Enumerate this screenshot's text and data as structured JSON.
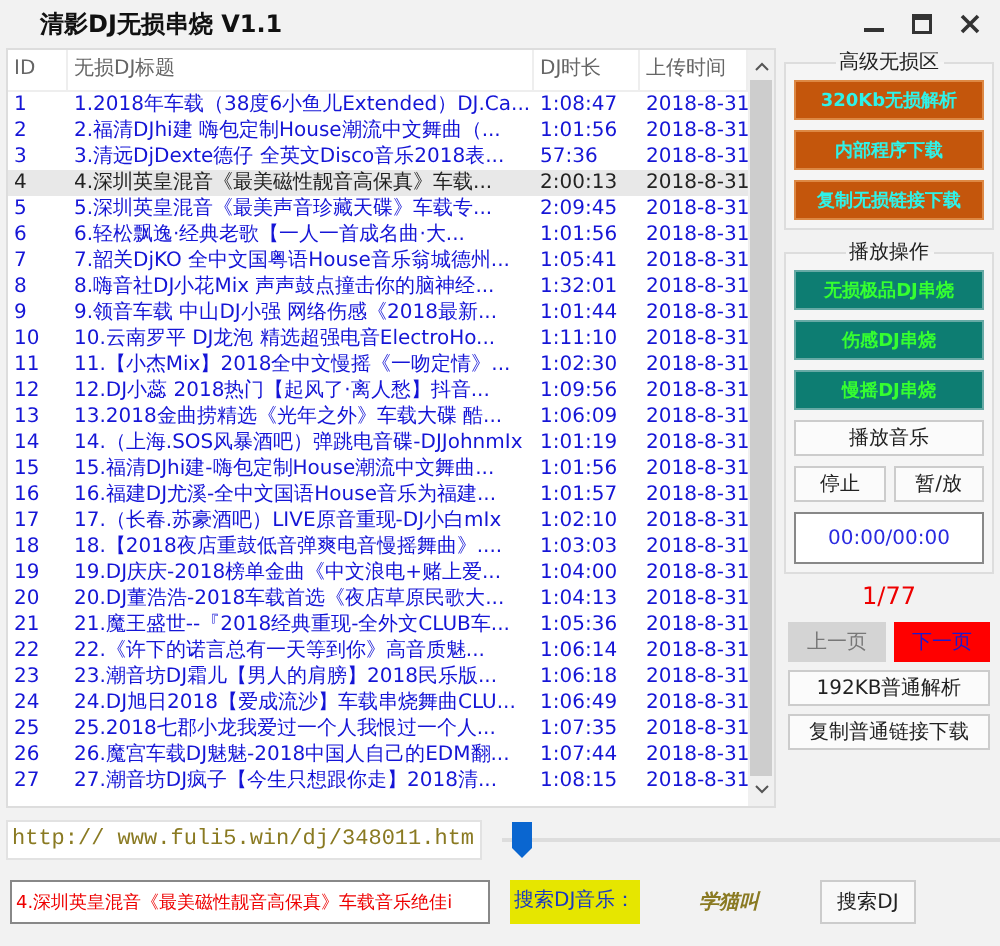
{
  "window": {
    "title": "清影DJ无损串烧 V1.1"
  },
  "table": {
    "columns": [
      "ID",
      "无损DJ标题",
      "DJ时长",
      "上传时间"
    ],
    "rows": [
      {
        "id": "1",
        "title": "1.2018年车载（38度6小鱼儿Extended）DJ.Ca...",
        "duration": "1:08:47",
        "date": "2018-8-31",
        "selected": false
      },
      {
        "id": "2",
        "title": "2.福清DJhi建 嗨包定制House潮流中文舞曲（...",
        "duration": "1:01:56",
        "date": "2018-8-31",
        "selected": false
      },
      {
        "id": "3",
        "title": "3.清远DjDexte德仔 全英文Disco音乐2018表...",
        "duration": "57:36",
        "date": "2018-8-31",
        "selected": false
      },
      {
        "id": "4",
        "title": "4.深圳英皇混音《最美磁性靓音高保真》车载...",
        "duration": "2:00:13",
        "date": "2018-8-31",
        "selected": true
      },
      {
        "id": "5",
        "title": "5.深圳英皇混音《最美声音珍藏天碟》车载专...",
        "duration": "2:09:45",
        "date": "2018-8-31",
        "selected": false
      },
      {
        "id": "6",
        "title": "6.轻松飘逸·经典老歌【一人一首成名曲·大...",
        "duration": "1:01:56",
        "date": "2018-8-31",
        "selected": false
      },
      {
        "id": "7",
        "title": "7.韶关DjKO 全中文国粤语House音乐翁城德州...",
        "duration": "1:05:41",
        "date": "2018-8-31",
        "selected": false
      },
      {
        "id": "8",
        "title": "8.嗨音社DJ小花Mix 声声鼓点撞击你的脑神经...",
        "duration": "1:32:01",
        "date": "2018-8-31",
        "selected": false
      },
      {
        "id": "9",
        "title": "9.领音车载 中山DJ小强 网络伤感《2018最新...",
        "duration": "1:01:44",
        "date": "2018-8-31",
        "selected": false
      },
      {
        "id": "10",
        "title": "10.云南罗平 DJ龙泡 精选超强电音ElectroHo...",
        "duration": "1:11:10",
        "date": "2018-8-31",
        "selected": false
      },
      {
        "id": "11",
        "title": "11.【小杰Mix】2018全中文慢摇《一吻定情》...",
        "duration": "1:02:30",
        "date": "2018-8-31",
        "selected": false
      },
      {
        "id": "12",
        "title": "12.DJ小蕊 2018热门【起风了·离人愁】抖音...",
        "duration": "1:09:56",
        "date": "2018-8-31",
        "selected": false
      },
      {
        "id": "13",
        "title": "13.2018金曲捞精选《光年之外》车载大碟 酷...",
        "duration": "1:06:09",
        "date": "2018-8-31",
        "selected": false
      },
      {
        "id": "14",
        "title": "14.（上海.SOS风暴酒吧）弹跳电音碟-DJJohnmIx",
        "duration": "1:01:19",
        "date": "2018-8-31",
        "selected": false
      },
      {
        "id": "15",
        "title": "15.福清DJhi建-嗨包定制House潮流中文舞曲...",
        "duration": "1:01:56",
        "date": "2018-8-31",
        "selected": false
      },
      {
        "id": "16",
        "title": "16.福建DJ尤溪-全中文国语House音乐为福建...",
        "duration": "1:01:57",
        "date": "2018-8-31",
        "selected": false
      },
      {
        "id": "17",
        "title": "17.（长春.苏豪酒吧）LIVE原音重现-DJ小白mIx",
        "duration": "1:02:10",
        "date": "2018-8-31",
        "selected": false
      },
      {
        "id": "18",
        "title": "18.【2018夜店重鼓低音弹爽电音慢摇舞曲》....",
        "duration": "1:03:03",
        "date": "2018-8-31",
        "selected": false
      },
      {
        "id": "19",
        "title": "19.DJ庆庆-2018榜单金曲《中文浪电+赌上爱...",
        "duration": "1:04:00",
        "date": "2018-8-31",
        "selected": false
      },
      {
        "id": "20",
        "title": "20.DJ董浩浩-2018车载首选《夜店草原民歌大...",
        "duration": "1:04:13",
        "date": "2018-8-31",
        "selected": false
      },
      {
        "id": "21",
        "title": "21.魔王盛世--『2018经典重现-全外文CLUB车...",
        "duration": "1:05:36",
        "date": "2018-8-31",
        "selected": false
      },
      {
        "id": "22",
        "title": "22.《许下的诺言总有一天等到你》高音质魅...",
        "duration": "1:06:14",
        "date": "2018-8-31",
        "selected": false
      },
      {
        "id": "23",
        "title": "23.潮音坊DJ霜儿【男人的肩膀】2018民乐版...",
        "duration": "1:06:18",
        "date": "2018-8-31",
        "selected": false
      },
      {
        "id": "24",
        "title": "24.DJ旭日2018【爱成流沙】车载串烧舞曲CLU...",
        "duration": "1:06:49",
        "date": "2018-8-31",
        "selected": false
      },
      {
        "id": "25",
        "title": "25.2018七郡小龙我爱过一个人我恨过一个人...",
        "duration": "1:07:35",
        "date": "2018-8-31",
        "selected": false
      },
      {
        "id": "26",
        "title": "26.魔宫车载DJ魅魅-2018中国人自己的EDM翻...",
        "duration": "1:07:44",
        "date": "2018-8-31",
        "selected": false
      },
      {
        "id": "27",
        "title": "27.潮音坊DJ疯子【今生只想跟你走】2018清...",
        "duration": "1:08:15",
        "date": "2018-8-31",
        "selected": false
      }
    ]
  },
  "lossless_group": {
    "title": "高级无损区",
    "buttons": [
      "320Kb无损解析",
      "内部程序下载",
      "复制无损链接下载"
    ]
  },
  "play_group": {
    "title": "播放操作",
    "category_buttons": [
      "无损极品DJ串烧",
      "伤感DJ串烧",
      "慢摇DJ串烧"
    ],
    "play_button": "播放音乐",
    "stop_button": "停止",
    "pause_button": "暂/放",
    "time": "00:00/00:00"
  },
  "pager": {
    "page": "1/77",
    "prev": {
      "label": "上一页",
      "disabled": true
    },
    "next": {
      "label": "下一页",
      "disabled": false
    }
  },
  "side_buttons": [
    "192KB普通解析",
    "复制普通链接下载"
  ],
  "url_field": {
    "value": "http:// www.fuli5.win/dj/348011.htm"
  },
  "progress": {
    "level": 0.02
  },
  "now_playing": "4.深圳英皇混音《最美磁性靓音高保真》车载音乐绝佳i",
  "search": {
    "label": "搜索DJ音乐：",
    "value": "学猫叫",
    "button": "搜索DJ"
  }
}
